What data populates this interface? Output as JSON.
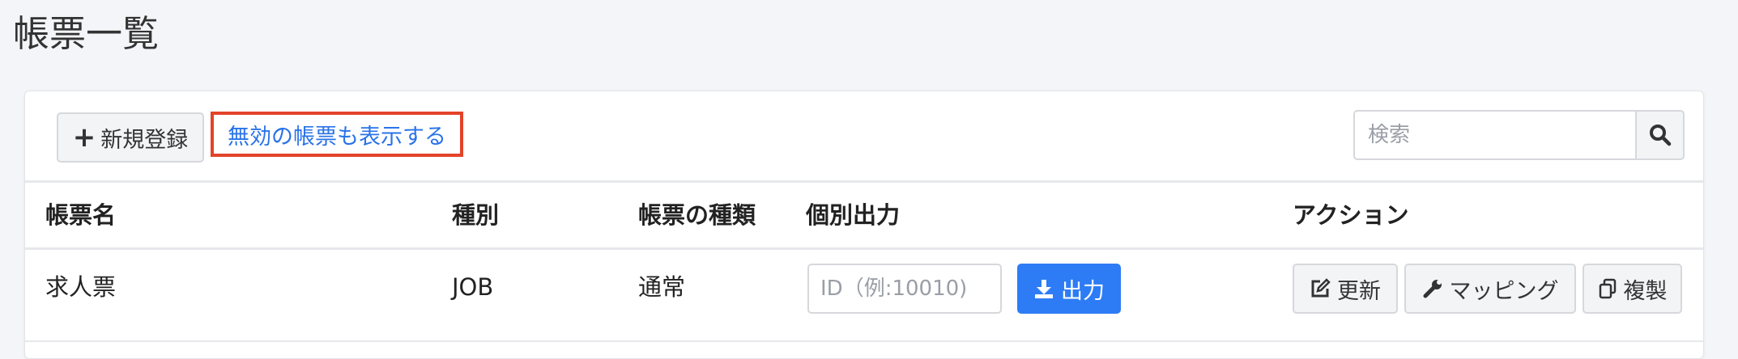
{
  "page": {
    "title": "帳票一覧"
  },
  "toolbar": {
    "new_label": "新規登録",
    "show_disabled_label": "無効の帳票も表示する",
    "search_placeholder": "検索"
  },
  "table": {
    "headers": [
      "帳票名",
      "種別",
      "帳票の種類",
      "個別出力",
      "アクション"
    ],
    "rows": [
      {
        "name": "求人票",
        "type": "JOB",
        "kind": "通常",
        "id_placeholder": "ID（例:10010)",
        "output_label": "出力",
        "actions": {
          "update": "更新",
          "mapping": "マッピング",
          "copy": "複製"
        }
      }
    ]
  },
  "icons": {
    "new": "plus-icon",
    "search": "search-icon",
    "output": "download-icon",
    "update": "edit-icon",
    "mapping": "wrench-icon",
    "copy": "copy-icon"
  },
  "colors": {
    "accent": "#2d7cf6",
    "link": "#2a73e8",
    "highlight_border": "#e3432a",
    "background": "#f4f5f8"
  }
}
